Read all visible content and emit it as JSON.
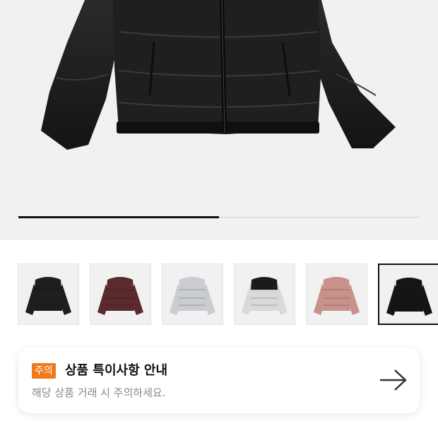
{
  "product_image": {
    "alt": "black puffer jacket",
    "carousel_progress": 0.5
  },
  "thumbnails": [
    {
      "color_name": "black glossy",
      "color": "#1e1e1e",
      "accent": "#1e1e1e",
      "selected": false
    },
    {
      "color_name": "burgundy",
      "color": "#5a2a2c",
      "accent": "#5a2a2c",
      "selected": false
    },
    {
      "color_name": "light grey",
      "color": "#c9cdd1",
      "accent": "#c9cdd1",
      "selected": false
    },
    {
      "color_name": "silver black",
      "color": "#d9d9d9",
      "accent": "#1b1b1b",
      "selected": false
    },
    {
      "color_name": "pink",
      "color": "#c8928a",
      "accent": "#c8928a",
      "selected": false
    },
    {
      "color_name": "black",
      "color": "#151515",
      "accent": "#151515",
      "selected": true
    }
  ],
  "notice": {
    "badge": "주의",
    "title": "상품 특이사항 안내",
    "description": "해당 상품 거래 시 주의하세요.",
    "arrow_icon": "arrow-right-icon"
  },
  "colors": {
    "badge": "#f07a1a",
    "progress": "#111111"
  }
}
